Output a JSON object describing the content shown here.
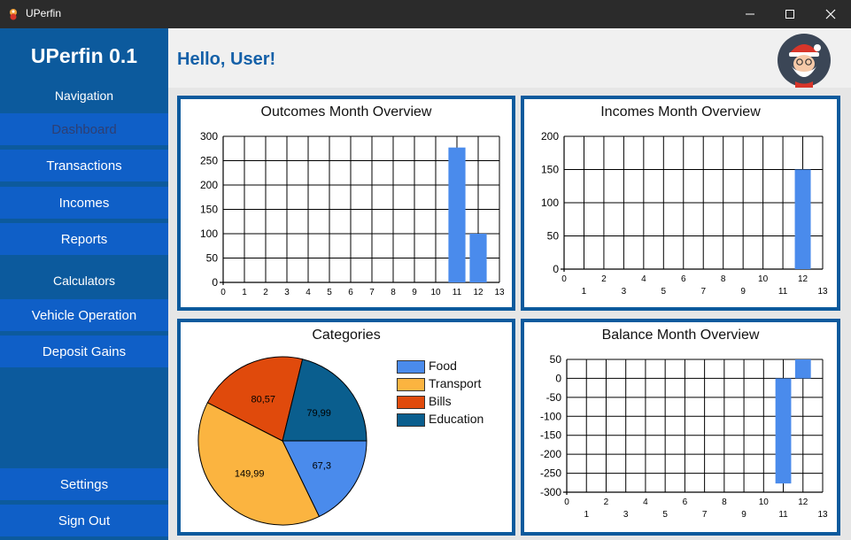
{
  "window": {
    "title": "UPerfin"
  },
  "sidebar": {
    "brand": "UPerfin 0.1",
    "nav_section": "Navigation",
    "items": [
      "Dashboard",
      "Transactions",
      "Incomes",
      "Reports"
    ],
    "calc_section": "Calculators",
    "calc_items": [
      "Vehicle Operation",
      "Deposit Gains"
    ],
    "bottom_items": [
      "Settings",
      "Sign Out"
    ]
  },
  "header": {
    "greeting": "Hello, User!"
  },
  "colors": {
    "accent": "#0c5a9d",
    "bar": "#4a8bec",
    "food": "#4a8bec",
    "transport": "#fbb440",
    "bills": "#e04a0c",
    "education": "#0a5e8e"
  },
  "chart_data": [
    {
      "type": "bar",
      "title": "Outcomes Month Overview",
      "x": [
        11,
        12
      ],
      "values": [
        277,
        100
      ],
      "xlim": [
        0,
        13
      ],
      "ylim": [
        0,
        300
      ],
      "yticks": [
        0,
        50,
        100,
        150,
        200,
        250,
        300
      ],
      "xticks": [
        0,
        1,
        2,
        3,
        4,
        5,
        6,
        7,
        8,
        9,
        10,
        11,
        12,
        13
      ],
      "grid": true
    },
    {
      "type": "bar",
      "title": "Incomes Month Overview",
      "x": [
        12
      ],
      "values": [
        150
      ],
      "xlim": [
        0,
        13
      ],
      "ylim": [
        0,
        200
      ],
      "yticks": [
        0,
        50,
        100,
        150,
        200
      ],
      "xticks": [
        0,
        1,
        2,
        3,
        4,
        5,
        6,
        7,
        8,
        9,
        10,
        11,
        12,
        13
      ],
      "grid": true
    },
    {
      "type": "pie",
      "title": "Categories",
      "categories": [
        "Food",
        "Transport",
        "Bills",
        "Education"
      ],
      "values": [
        67.3,
        149.99,
        80.57,
        79.99
      ],
      "labels": [
        "67,3",
        "149,99",
        "80,57",
        "79,99"
      ],
      "legend": "right"
    },
    {
      "type": "bar",
      "title": "Balance Month Overview",
      "x": [
        11,
        12
      ],
      "values": [
        -277,
        50
      ],
      "xlim": [
        0,
        13
      ],
      "ylim": [
        -300,
        50
      ],
      "yticks": [
        -300,
        -250,
        -200,
        -150,
        -100,
        -50,
        0,
        50
      ],
      "xticks": [
        0,
        1,
        2,
        3,
        4,
        5,
        6,
        7,
        8,
        9,
        10,
        11,
        12,
        13
      ],
      "grid": true
    }
  ]
}
